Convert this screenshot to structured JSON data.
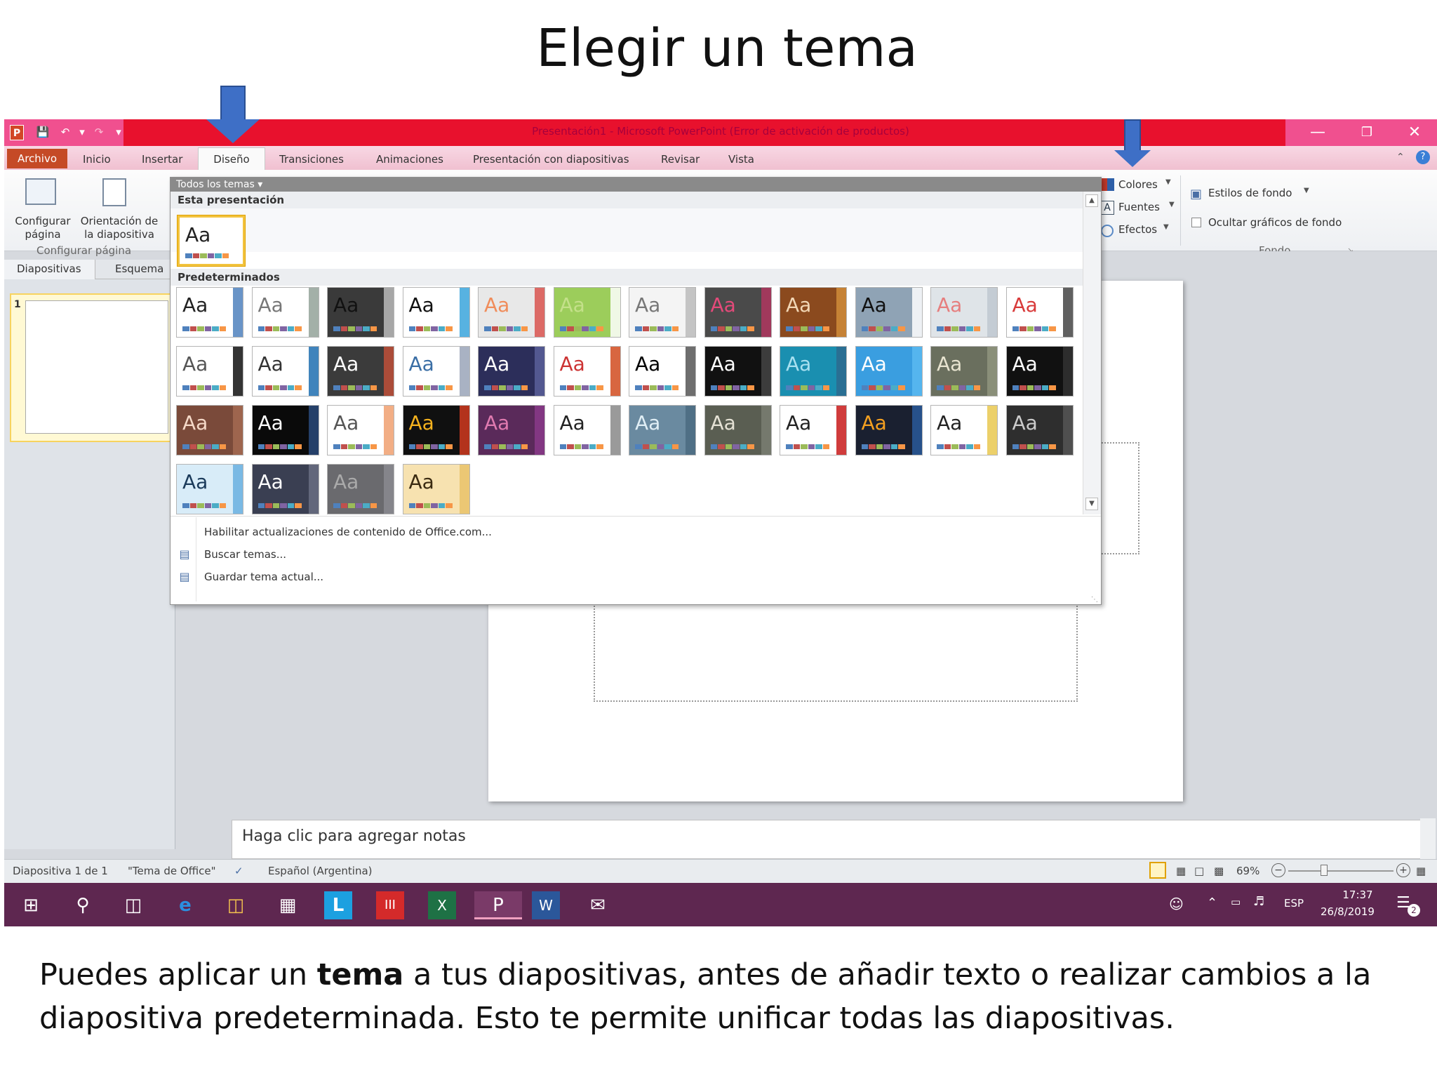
{
  "slide": {
    "title": "Elegir un tema",
    "caption_pre": "Puedes aplicar un ",
    "caption_bold": "tema",
    "caption_post": " a tus diapositivas, antes de añadir texto o realizar cambios a la diapositiva predeterminada. Esto te permite unificar todas las diapositivas."
  },
  "window": {
    "title": "Presentación1 - Microsoft PowerPoint (Error de activación de productos)",
    "app_letter": "P"
  },
  "tabs": {
    "file": "Archivo",
    "items": [
      "Inicio",
      "Insertar",
      "Diseño",
      "Transiciones",
      "Animaciones",
      "Presentación con diapositivas",
      "Revisar",
      "Vista"
    ]
  },
  "ribbon": {
    "configurar_pagina": "Configurar página",
    "orientacion": "Orientación de la diapositiva",
    "group_label": "Configurar página",
    "colores": "Colores",
    "fuentes": "Fuentes",
    "efectos": "Efectos",
    "estilos_fondo": "Estilos de fondo",
    "ocultar_graficos": "Ocultar gráficos de fondo",
    "fondo_label": "Fondo"
  },
  "pane": {
    "tab_slides": "Diapositivas",
    "tab_outline": "Esquema",
    "slide_number": "1"
  },
  "dropdown": {
    "header": "Todos los temas",
    "section_current": "Esta presentación",
    "section_builtin": "Predeterminados",
    "theme_label": "Aa",
    "menu": [
      "Habilitar actualizaciones de contenido de Office.com...",
      "Buscar temas...",
      "Guardar tema actual..."
    ]
  },
  "themes": [
    {
      "bg": "#ffffff",
      "fg": "#222222",
      "accent": "#4f81bd"
    },
    {
      "bg": "#ffffff",
      "fg": "#777777",
      "accent": "#93a299"
    },
    {
      "bg": "#3a3a3a",
      "fg": "#111111",
      "accent": "#bbbbbb"
    },
    {
      "bg": "#ffffff",
      "fg": "#111111",
      "accent": "#3aa5dc"
    },
    {
      "bg": "#e8e8e8",
      "fg": "#f08c5a",
      "accent": "#d9534f"
    },
    {
      "bg": "#9ccd5b",
      "fg": "#c4e08a",
      "accent": "#ffffff"
    },
    {
      "bg": "#f4f4f4",
      "fg": "#777777",
      "accent": "#bbbbbb"
    },
    {
      "bg": "#4a4a4a",
      "fg": "#e44a7a",
      "accent": "#b0365f"
    },
    {
      "bg": "#8b4a1e",
      "fg": "#f2d7b5",
      "accent": "#d08c3a"
    },
    {
      "bg": "#8fa3b5",
      "fg": "#111111",
      "accent": "#ffffff"
    },
    {
      "bg": "#dfe4e8",
      "fg": "#e67e7e",
      "accent": "#c0c8d0"
    },
    {
      "bg": "#ffffff",
      "fg": "#d83a3a",
      "accent": "#444444"
    },
    {
      "bg": "#ffffff",
      "fg": "#555555",
      "accent": "#111111"
    },
    {
      "bg": "#ffffff",
      "fg": "#333333",
      "accent": "#1e6fb0"
    },
    {
      "bg": "#3b3b3b",
      "fg": "#ffffff",
      "accent": "#c0503a"
    },
    {
      "bg": "#ffffff",
      "fg": "#3a6ea5",
      "accent": "#9aa5b8"
    },
    {
      "bg": "#2c2e5a",
      "fg": "#ffffff",
      "accent": "#5a5f9a"
    },
    {
      "bg": "#ffffff",
      "fg": "#c33",
      "accent": "#d14b1f"
    },
    {
      "bg": "#ffffff",
      "fg": "#000000",
      "accent": "#555555"
    },
    {
      "bg": "#111111",
      "fg": "#ffffff",
      "accent": "#444444"
    },
    {
      "bg": "#1a8fb0",
      "fg": "#a7e0f0",
      "accent": "#2e6a8e"
    },
    {
      "bg": "#3a9ee0",
      "fg": "#ffffff",
      "accent": "#5ab8f0"
    },
    {
      "bg": "#6a6f5e",
      "fg": "#e8e4d0",
      "accent": "#8f957e"
    },
    {
      "bg": "#111111",
      "fg": "#ffffff",
      "accent": "#333333"
    },
    {
      "bg": "#7a4a3a",
      "fg": "#f5d9c8",
      "accent": "#a56a52"
    },
    {
      "bg": "#0a0a0a",
      "fg": "#ffffff",
      "accent": "#2a4a7a"
    },
    {
      "bg": "#ffffff",
      "fg": "#555555",
      "accent": "#f0a070"
    },
    {
      "bg": "#101010",
      "fg": "#f5b21e",
      "accent": "#d03a1e"
    },
    {
      "bg": "#5a2a5a",
      "fg": "#e07ab0",
      "accent": "#8a3a8a"
    },
    {
      "bg": "#ffffff",
      "fg": "#222222",
      "accent": "#888888"
    },
    {
      "bg": "#6a8aa0",
      "fg": "#e0eef5",
      "accent": "#4a6a80"
    },
    {
      "bg": "#5a5e52",
      "fg": "#e5e2d5",
      "accent": "#7a7e72"
    },
    {
      "bg": "#ffffff",
      "fg": "#222222",
      "accent": "#c81a1a"
    },
    {
      "bg": "#1a2030",
      "fg": "#f5a020",
      "accent": "#2a5a9a"
    },
    {
      "bg": "#ffffff",
      "fg": "#222222",
      "accent": "#e9c850"
    },
    {
      "bg": "#2e2e2e",
      "fg": "#cccccc",
      "accent": "#555555"
    },
    {
      "bg": "#d8ecf8",
      "fg": "#1a3a5a",
      "accent": "#6ab0e0"
    },
    {
      "bg": "#3a3f52",
      "fg": "#ffffff",
      "accent": "#6a6f82"
    },
    {
      "bg": "#6a6a6e",
      "fg": "#aaaaaa",
      "accent": "#8a8a90"
    },
    {
      "bg": "#f7e2b0",
      "fg": "#3a2a10",
      "accent": "#e9c26a"
    }
  ],
  "canvas": {
    "notes_placeholder": "Haga clic para agregar notas"
  },
  "status": {
    "slide_info": "Diapositiva 1 de 1",
    "theme_name": "\"Tema de Office\"",
    "language": "Español (Argentina)",
    "zoom": "69%"
  },
  "taskbar": {
    "lang": "ESP",
    "time": "17:37",
    "date": "26/8/2019",
    "notif_count": "2"
  },
  "colors": {
    "titlebar": "#e8112d",
    "accent_pink": "#f0508f",
    "taskbar": "#5e2750",
    "arrow": "#3e6fc6"
  },
  "icons": [
    "save-icon",
    "undo-icon",
    "redo-icon",
    "windows-start-icon",
    "search-icon",
    "task-view-icon",
    "edge-icon",
    "folder-icon",
    "store-icon",
    "word-icon",
    "excel-icon",
    "powerpoint-icon"
  ]
}
